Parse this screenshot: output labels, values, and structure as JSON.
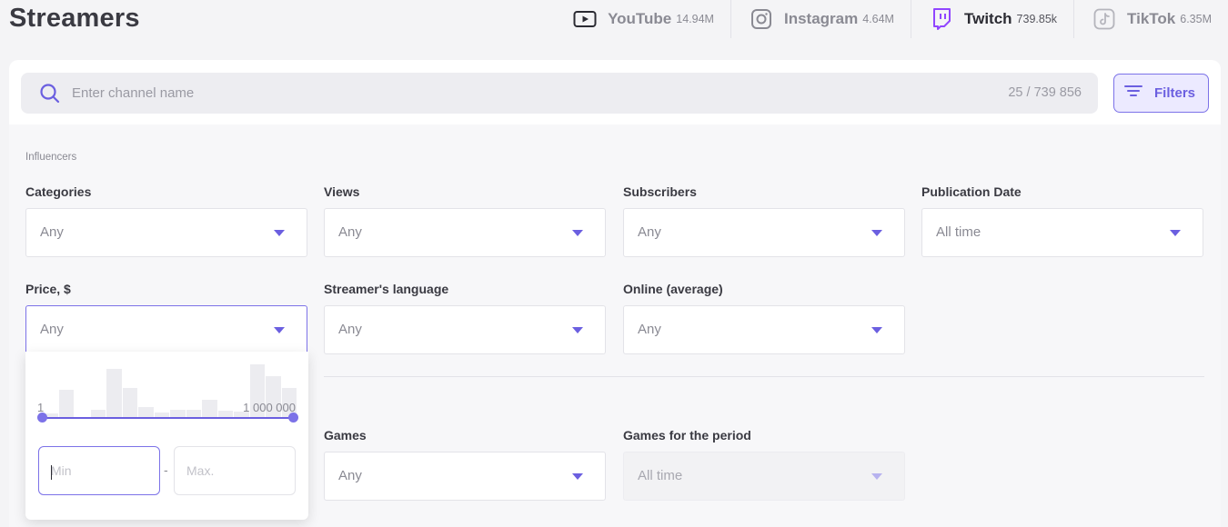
{
  "page": {
    "title": "Streamers"
  },
  "platforms": [
    {
      "name": "YouTube",
      "count": "14.94M",
      "icon": "youtube-icon",
      "active": false
    },
    {
      "name": "Instagram",
      "count": "4.64M",
      "icon": "instagram-icon",
      "active": false
    },
    {
      "name": "Twitch",
      "count": "739.85k",
      "icon": "twitch-icon",
      "active": true
    },
    {
      "name": "TikTok",
      "count": "6.35M",
      "icon": "tiktok-icon",
      "active": false
    }
  ],
  "search": {
    "placeholder": "Enter channel name",
    "counter": "25 / 739 856"
  },
  "filters_button": {
    "label": "Filters"
  },
  "section": {
    "label": "Influencers"
  },
  "filters": {
    "categories": {
      "label": "Categories",
      "value": "Any"
    },
    "views": {
      "label": "Views",
      "value": "Any"
    },
    "subscribers": {
      "label": "Subscribers",
      "value": "Any"
    },
    "publication_date": {
      "label": "Publication Date",
      "value": "All time"
    },
    "price": {
      "label": "Price, $",
      "value": "Any"
    },
    "language": {
      "label": "Streamer's language",
      "value": "Any"
    },
    "online": {
      "label": "Online (average)",
      "value": "Any"
    },
    "games": {
      "label": "Games",
      "value": "Any"
    },
    "games_period": {
      "label": "Games for the period",
      "value": "All time"
    }
  },
  "price_range": {
    "min_label": "1",
    "max_label": "1 000 000",
    "min_placeholder": "Min",
    "max_placeholder": "Max.",
    "separator": "-",
    "selected_min_fraction": 0,
    "selected_max_fraction": 1,
    "histogram": [
      0.08,
      0.52,
      0.0,
      0.16,
      0.92,
      0.56,
      0.2,
      0.1,
      0.16,
      0.16,
      0.34,
      0.14,
      0.12,
      1.0,
      0.78,
      0.56
    ]
  },
  "colors": {
    "accent": "#6b5fe0",
    "twitch": "#9146ff"
  }
}
